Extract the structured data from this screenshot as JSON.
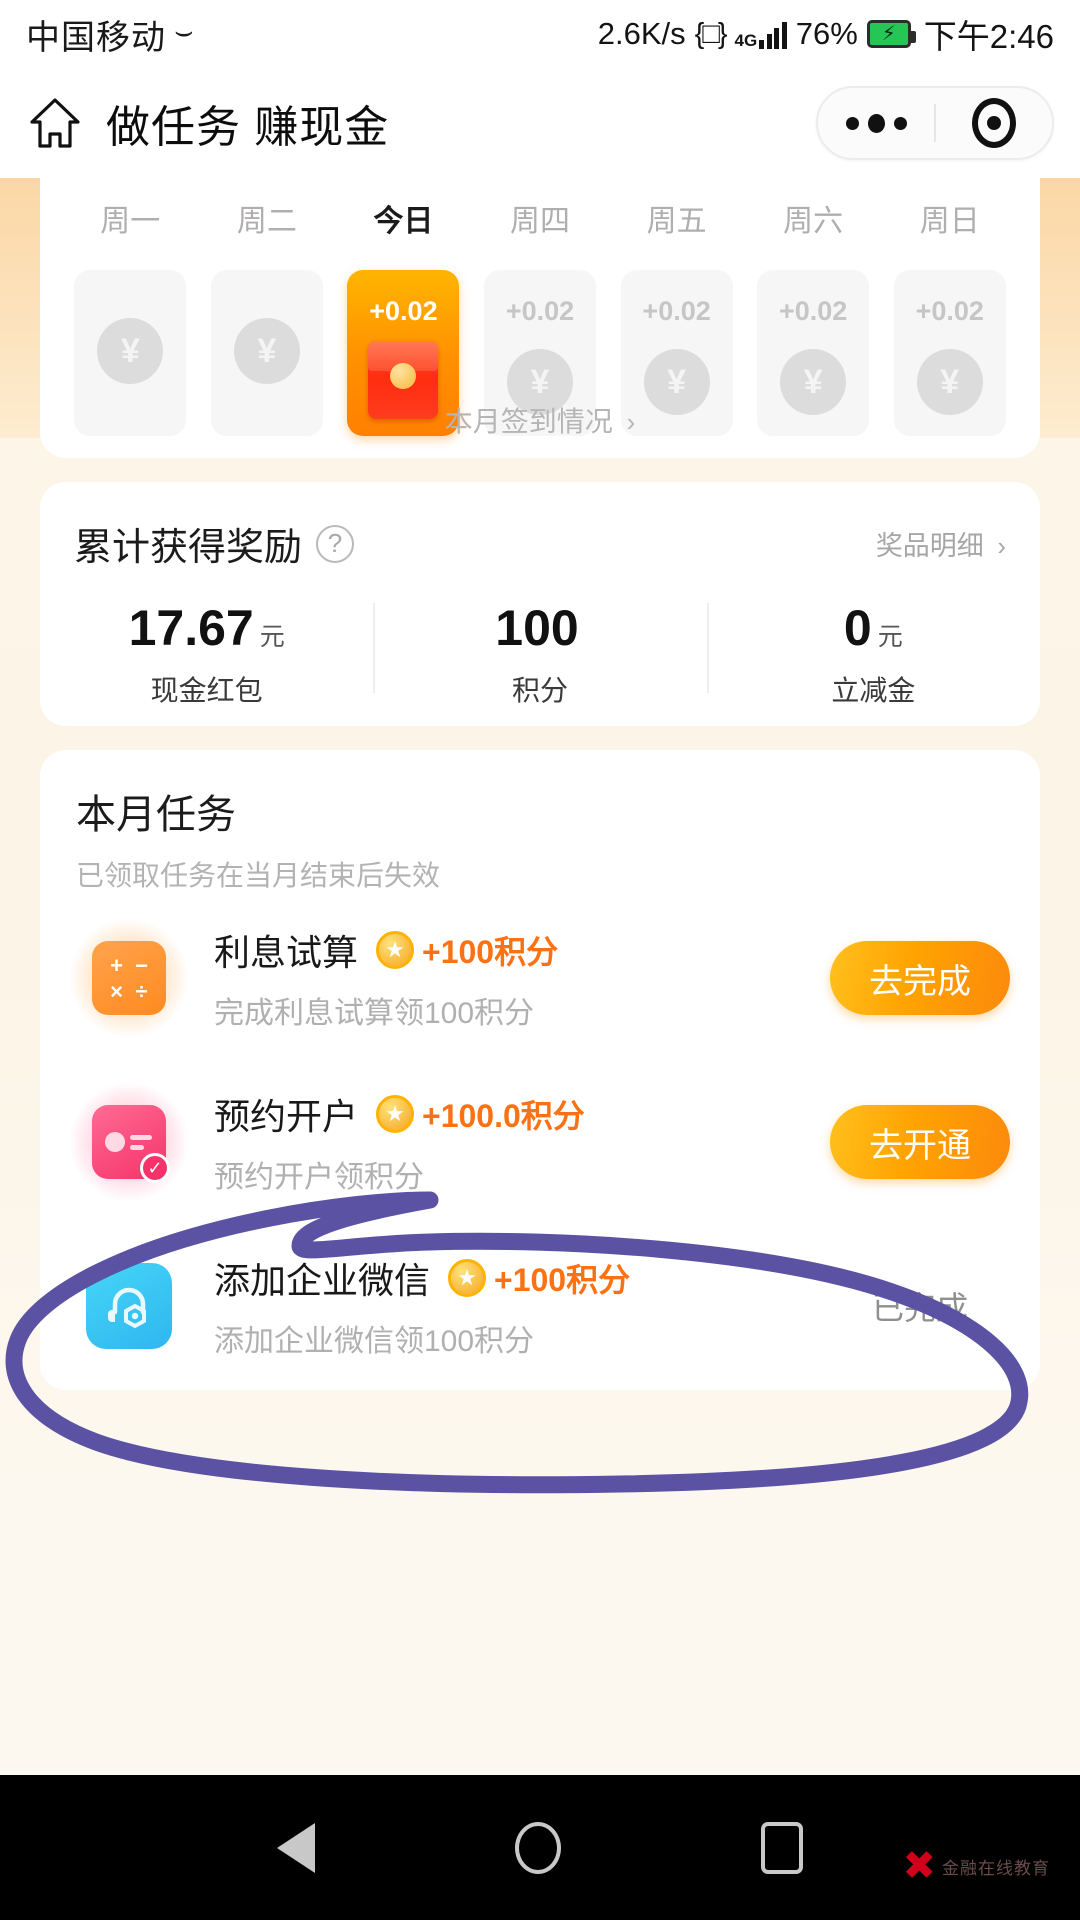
{
  "status_bar": {
    "carrier": "中国移动",
    "network_speed": "2.6K/s",
    "network_type": "4G",
    "battery_percent": "76%",
    "time": "下午2:46"
  },
  "title_bar": {
    "home_icon": "home-icon",
    "title": "做任务 赚现金",
    "capsule": {
      "more_icon": "ellipsis-icon",
      "target_icon": "target-circle-icon"
    }
  },
  "signin": {
    "days": [
      {
        "label": "周一",
        "amount": "",
        "state": "claimed",
        "is_today": false
      },
      {
        "label": "周二",
        "amount": "",
        "state": "claimed",
        "is_today": false
      },
      {
        "label": "今日",
        "amount": "+0.02",
        "state": "today",
        "is_today": true
      },
      {
        "label": "周四",
        "amount": "+0.02",
        "state": "upcoming",
        "is_today": false
      },
      {
        "label": "周五",
        "amount": "+0.02",
        "state": "upcoming",
        "is_today": false
      },
      {
        "label": "周六",
        "amount": "+0.02",
        "state": "upcoming",
        "is_today": false
      },
      {
        "label": "周日",
        "amount": "+0.02",
        "state": "upcoming",
        "is_today": false
      }
    ],
    "month_link": "本月签到情况",
    "chevron": "›",
    "yen_symbol": "¥"
  },
  "rewards": {
    "title": "累计获得奖励",
    "help_icon": "?",
    "detail_link": "奖品明细",
    "chevron": "›",
    "stats": [
      {
        "value": "17.67",
        "unit": "元",
        "label": "现金红包"
      },
      {
        "value": "100",
        "unit": "",
        "label": "积分"
      },
      {
        "value": "0",
        "unit": "元",
        "label": "立减金"
      }
    ]
  },
  "tasks": {
    "title": "本月任务",
    "subtitle": "已领取任务在当月结束后失效",
    "items": [
      {
        "name": "利息试算",
        "points": "+100积分",
        "desc": "完成利息试算领100积分",
        "action": "去完成",
        "action_type": "button",
        "icon": "calculator-icon",
        "calc_symbols": [
          "+",
          "−",
          "×",
          "÷"
        ]
      },
      {
        "name": "预约开户",
        "points": "+100.0积分",
        "desc": "预约开户领积分",
        "action": "去开通",
        "action_type": "button",
        "icon": "id-card-icon",
        "check": "✓"
      },
      {
        "name": "添加企业微信",
        "points": "+100积分",
        "desc": "添加企业微信领100积分",
        "action": "已完成",
        "action_type": "status",
        "icon": "wecom-service-icon"
      }
    ]
  },
  "annotation": {
    "shape": "hand-drawn-circle",
    "color": "#5b52a3"
  },
  "nav_bar": {
    "back": "back-triangle-icon",
    "home": "home-circle-icon",
    "recents": "recents-square-icon"
  },
  "watermark": {
    "logo": "✖",
    "text": "金融在线教育"
  },
  "colors": {
    "accent_orange": "#ff9000",
    "points_orange": "#fb7215",
    "page_bg": "#fdf6ea",
    "annotation_purple": "#5b52a3"
  }
}
